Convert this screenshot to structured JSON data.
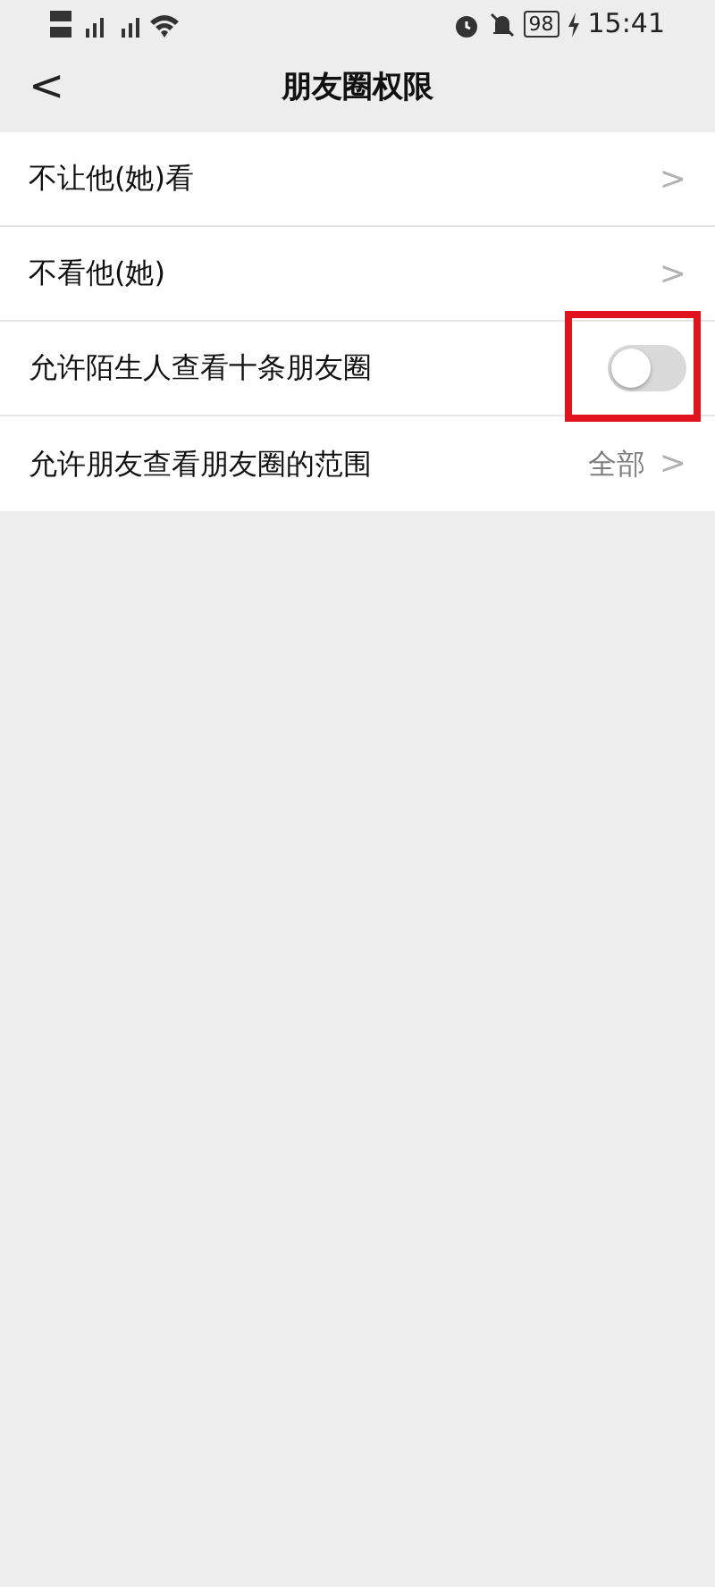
{
  "status_bar": {
    "time": "15:41",
    "battery": "98"
  },
  "nav_bar": {
    "back": "<",
    "title": "朋友圈权限"
  },
  "rows": [
    {
      "kind": "link",
      "label": "不让他(她)看",
      "arrow": ">"
    },
    {
      "kind": "link",
      "label": "不看他(她)",
      "arrow": ">"
    },
    {
      "kind": "toggle",
      "label": "允许陌生人查看十条朋友圈",
      "on": false,
      "highlighted": true
    },
    {
      "kind": "link",
      "label": "允许朋友查看朋友圈的范围",
      "value": "全部",
      "arrow": ">"
    }
  ]
}
